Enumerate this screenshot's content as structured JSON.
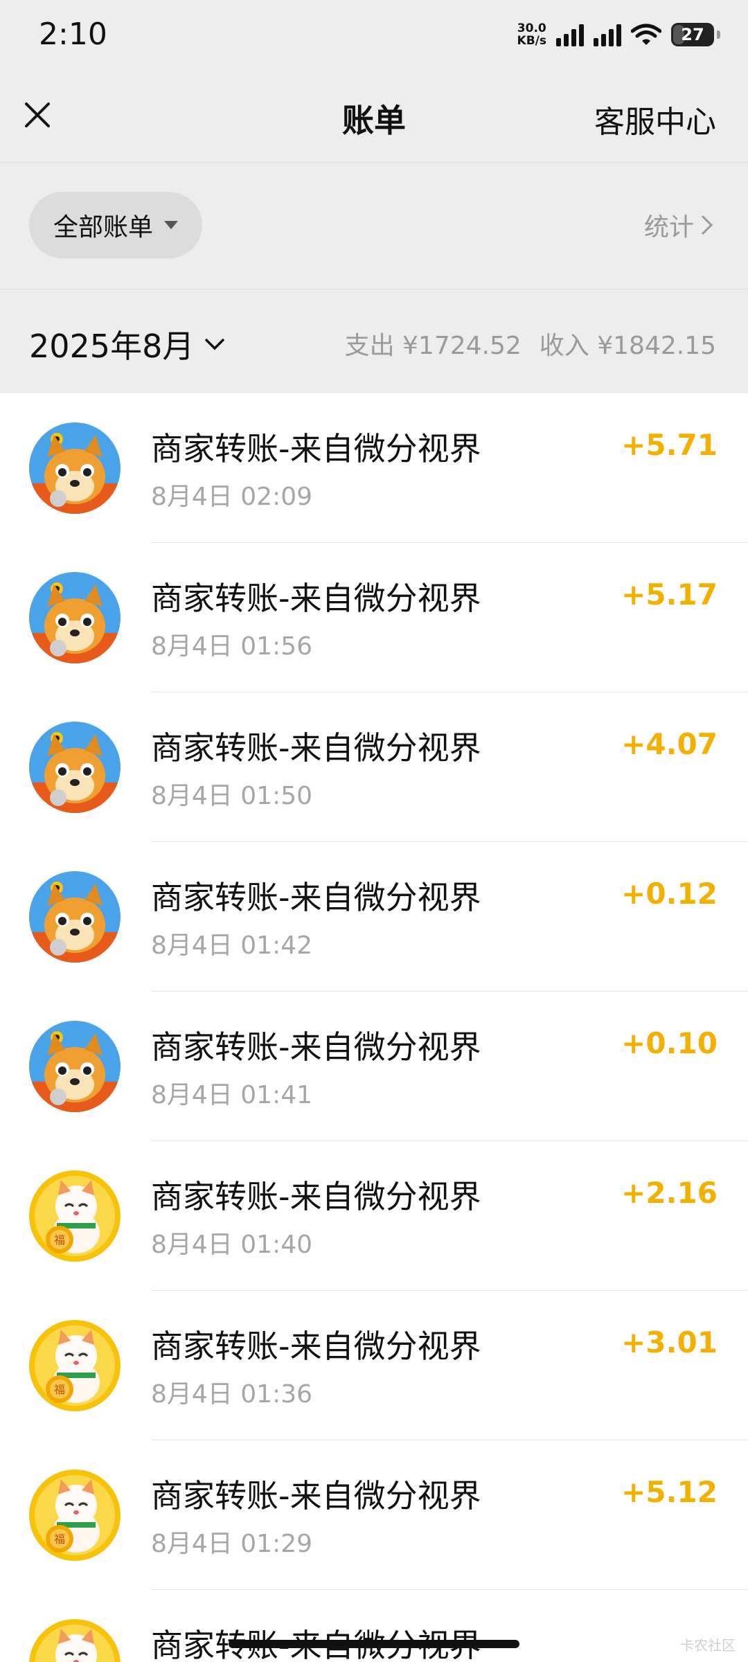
{
  "status": {
    "time": "2:10",
    "net_speed_top": "30.0",
    "net_speed_bottom": "KB/s",
    "battery": "27"
  },
  "nav": {
    "close_icon": "close-icon",
    "title": "账单",
    "service": "客服中心"
  },
  "filter": {
    "all_bills": "全部账单",
    "stats": "统计"
  },
  "month": {
    "label": "2025年8月",
    "expense": "支出 ¥1724.52",
    "income": "收入 ¥1842.15"
  },
  "colors": {
    "amount": "#f3b000",
    "background": "#ededed"
  },
  "transactions": [
    {
      "name": "商家转账-来自微分视界",
      "time": "8月4日 02:09",
      "amount": "+5.71",
      "avatar": "dog-avatar"
    },
    {
      "name": "商家转账-来自微分视界",
      "time": "8月4日 01:56",
      "amount": "+5.17",
      "avatar": "dog-avatar"
    },
    {
      "name": "商家转账-来自微分视界",
      "time": "8月4日 01:50",
      "amount": "+4.07",
      "avatar": "dog-avatar"
    },
    {
      "name": "商家转账-来自微分视界",
      "time": "8月4日 01:42",
      "amount": "+0.12",
      "avatar": "dog-avatar"
    },
    {
      "name": "商家转账-来自微分视界",
      "time": "8月4日 01:41",
      "amount": "+0.10",
      "avatar": "dog-avatar"
    },
    {
      "name": "商家转账-来自微分视界",
      "time": "8月4日 01:40",
      "amount": "+2.16",
      "avatar": "lucky-cat-avatar"
    },
    {
      "name": "商家转账-来自微分视界",
      "time": "8月4日 01:36",
      "amount": "+3.01",
      "avatar": "lucky-cat-avatar"
    },
    {
      "name": "商家转账-来自微分视界",
      "time": "8月4日 01:29",
      "amount": "+5.12",
      "avatar": "lucky-cat-avatar"
    },
    {
      "name": "商家转账-来自微分视界",
      "time": "",
      "amount": "",
      "avatar": "lucky-cat-avatar"
    }
  ],
  "watermark": "卡农社区"
}
